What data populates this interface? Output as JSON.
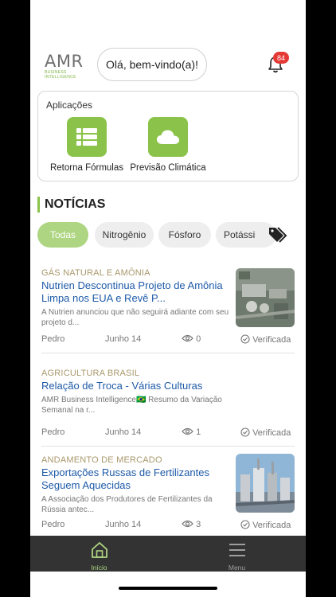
{
  "header": {
    "logo_text": "AMR",
    "logo_subtitle": "BUSINESS INTELLIGENCE",
    "greeting": "Olá, bem-vindo(a)!",
    "notification_count": "84"
  },
  "applications": {
    "title": "Aplicações",
    "items": [
      {
        "label": "Retorna Fórmulas",
        "icon": "table-list-icon"
      },
      {
        "label": "Previsão Climática",
        "icon": "cloud-icon"
      }
    ]
  },
  "news": {
    "title": "NOTÍCIAS",
    "filters": [
      "Todas",
      "Nitrogênio",
      "Fósforo",
      "Potássi"
    ],
    "active_filter": "Todas",
    "items": [
      {
        "category": "GÁS NATURAL E AMÔNIA",
        "title": "Nutrien Descontinua Projeto de Amônia Limpa nos EUA e Revê P...",
        "summary": "A Nutrien anunciou que não seguirá adiante com seu projeto d...",
        "author": "Pedro",
        "date": "Junho 14",
        "views": "0",
        "status": "Verificada",
        "has_image": true
      },
      {
        "category": "AGRICULTURA BRASIL",
        "title": "Relação de Troca - Várias Culturas",
        "summary": "AMR Business Intelligence🇧🇷 Resumo da Variação Semanal na r...",
        "author": "Pedro",
        "date": "Junho 14",
        "views": "1",
        "status": "Verificada",
        "has_image": false
      },
      {
        "category": "ANDAMENTO DE MERCADO",
        "title": "Exportações Russas de Fertilizantes Seguem Aquecidas",
        "summary": "A Associação dos Produtores de Fertilizantes da Rússia antec...",
        "author": "Pedro",
        "date": "Junho 14",
        "views": "3",
        "status": "Verificada",
        "has_image": true
      }
    ]
  },
  "tabbar": {
    "items": [
      {
        "label": "Início",
        "icon": "home-icon",
        "active": true
      },
      {
        "label": "Menu",
        "icon": "hamburger-menu-icon",
        "active": false
      }
    ]
  },
  "colors": {
    "accent": "#8bc34a",
    "link": "#1e5aa8",
    "category": "#a8986b",
    "badge": "#e53935",
    "tabbar": "#333333"
  }
}
